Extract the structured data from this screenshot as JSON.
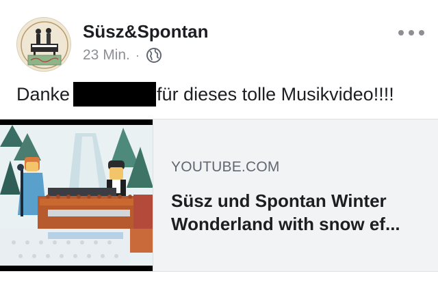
{
  "post": {
    "author": "Süsz&Spontan",
    "timestamp": "23 Min.",
    "separator": "·",
    "privacy_icon": "globe-icon",
    "more_icon": "more-options-icon",
    "message_before": "Danke",
    "message_after": "für dieses tolle Musikvideo!!!!"
  },
  "link_preview": {
    "domain": "YOUTUBE.COM",
    "title": "Süsz und Spontan Winter Wonderland with snow ef..."
  },
  "avatar_logo_text": "Süsz&Spontan",
  "colors": {
    "text_primary": "#1c1e21",
    "text_secondary": "#8c8f94",
    "card_background": "#f2f3f5",
    "card_border": "#dddfe2"
  }
}
